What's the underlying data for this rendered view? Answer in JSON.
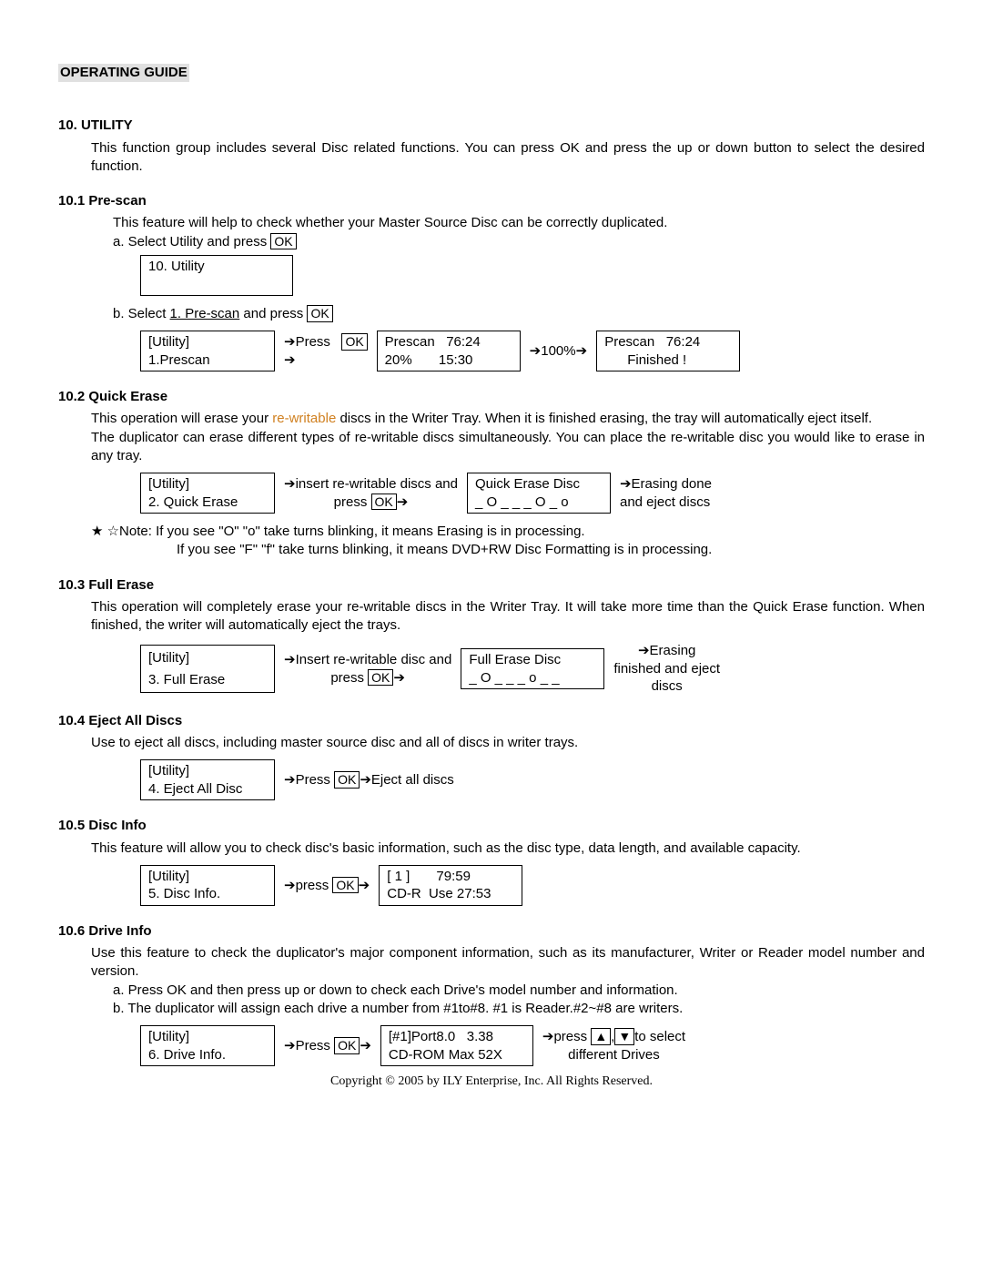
{
  "title": "OPERATING GUIDE",
  "s10": {
    "head": "10.  UTILITY",
    "body": "This function group includes several Disc related functions. You can press OK and press the up or down button to select the desired function."
  },
  "s101": {
    "head": "10.1 Pre-scan",
    "body": "This feature will help to check whether your Master Source Disc can be correctly duplicated.",
    "stepA_pre": "a. Select Utility and press ",
    "ok": "OK",
    "lcd1_l1": "10. Utility",
    "lcd1_l2": " ",
    "stepB_pre": "b. Select ",
    "stepB_u": "1. Pre-scan",
    "stepB_post": " and press ",
    "lcd2_l1": "[Utility]",
    "lcd2_l2": "1.Prescan",
    "mid1a": "➔Press",
    "mid1b": "➔",
    "lcd3_l1": "Prescan   76:24",
    "lcd3_l2": "20%       15:30",
    "mid2": "➔100%➔",
    "lcd4_l1": "Prescan   76:24",
    "lcd4_l2": "      Finished !"
  },
  "s102": {
    "head": "10.2 Quick Erase",
    "body1a": "This operation will erase your ",
    "body1b": "re-writable",
    "body1c": " discs in the Writer Tray. When it is finished erasing, the tray will automatically eject itself.",
    "body2": "The duplicator can erase different types of re-writable discs simultaneously. You can place the re-writable disc you would like to erase in any tray.",
    "lcd1_l1": "[Utility]",
    "lcd1_l2": "2. Quick Erase",
    "mid_l1": "➔insert re-writable discs and",
    "mid_l2a": "press ",
    "mid_l2b": "➔",
    "lcd2_l1": "Quick Erase Disc",
    "lcd2_l2": "_ O _ _ _ O _ o",
    "after_l1": "➔Erasing done",
    "after_l2": "and eject discs",
    "note1": "★ ☆Note:  If you see \"O\" \"o\" take turns blinking, it means Erasing is in processing.",
    "note2": "If you see \"F\" \"f\" take turns blinking, it means DVD+RW Disc Formatting is in processing."
  },
  "s103": {
    "head": "10.3 Full Erase",
    "body": "This operation will completely erase your re-writable discs in the Writer Tray. It will take more time than the Quick Erase function. When finished, the writer will automatically eject the trays.",
    "lcd1_l1": "[Utility]",
    "lcd1_l2": "3. Full Erase",
    "mid_l1": "➔Insert re-writable disc and",
    "mid_l2a": "press ",
    "mid_l2b": "➔",
    "lcd2_l1": "Full Erase Disc",
    "lcd2_l2": "_ O _ _ _ o _ _",
    "after_l1": "➔Erasing",
    "after_l2": "finished and eject",
    "after_l3": "discs"
  },
  "s104": {
    "head": "10.4 Eject All Discs",
    "body": "Use to eject all discs, including master source disc and all of discs in writer trays.",
    "lcd1_l1": "[Utility]",
    "lcd1_l2": "4. Eject All Disc",
    "mida": "➔Press ",
    "midb": "➔Eject all discs"
  },
  "s105": {
    "head": "10.5 Disc Info",
    "body": "This feature will allow you to check disc's basic information, such as the disc type, data length, and available capacity.",
    "lcd1_l1": "[Utility]",
    "lcd1_l2": "5. Disc Info.",
    "mida": "➔press ",
    "midb": "➔",
    "lcd2_l1": "[ 1 ]       79:59",
    "lcd2_l2": "CD-R  Use 27:53"
  },
  "s106": {
    "head": "10.6 Drive Info",
    "body": "Use this feature to check the duplicator's major component information, such as its manufacturer, Writer or Reader model number and version.",
    "stepA": "a. Press OK and then press up or down to check each Drive's model number and information.",
    "stepB": "b. The duplicator will assign each drive a number from #1to#8. #1 is Reader.#2~#8 are writers.",
    "lcd1_l1": "[Utility]",
    "lcd1_l2": "6. Drive Info.",
    "mida": "➔Press ",
    "midb": "➔",
    "lcd2_l1": "[#1]Port8.0   3.38",
    "lcd2_l2": "CD-ROM Max 52X",
    "aftera": "➔press ",
    "up": "▲",
    "comma": ",",
    "down": "▼",
    "afterb": "to select",
    "afterc": "different Drives"
  },
  "footer": "Copyright © 2005 by ILY Enterprise, Inc. All Rights Reserved.",
  "ok": "OK"
}
